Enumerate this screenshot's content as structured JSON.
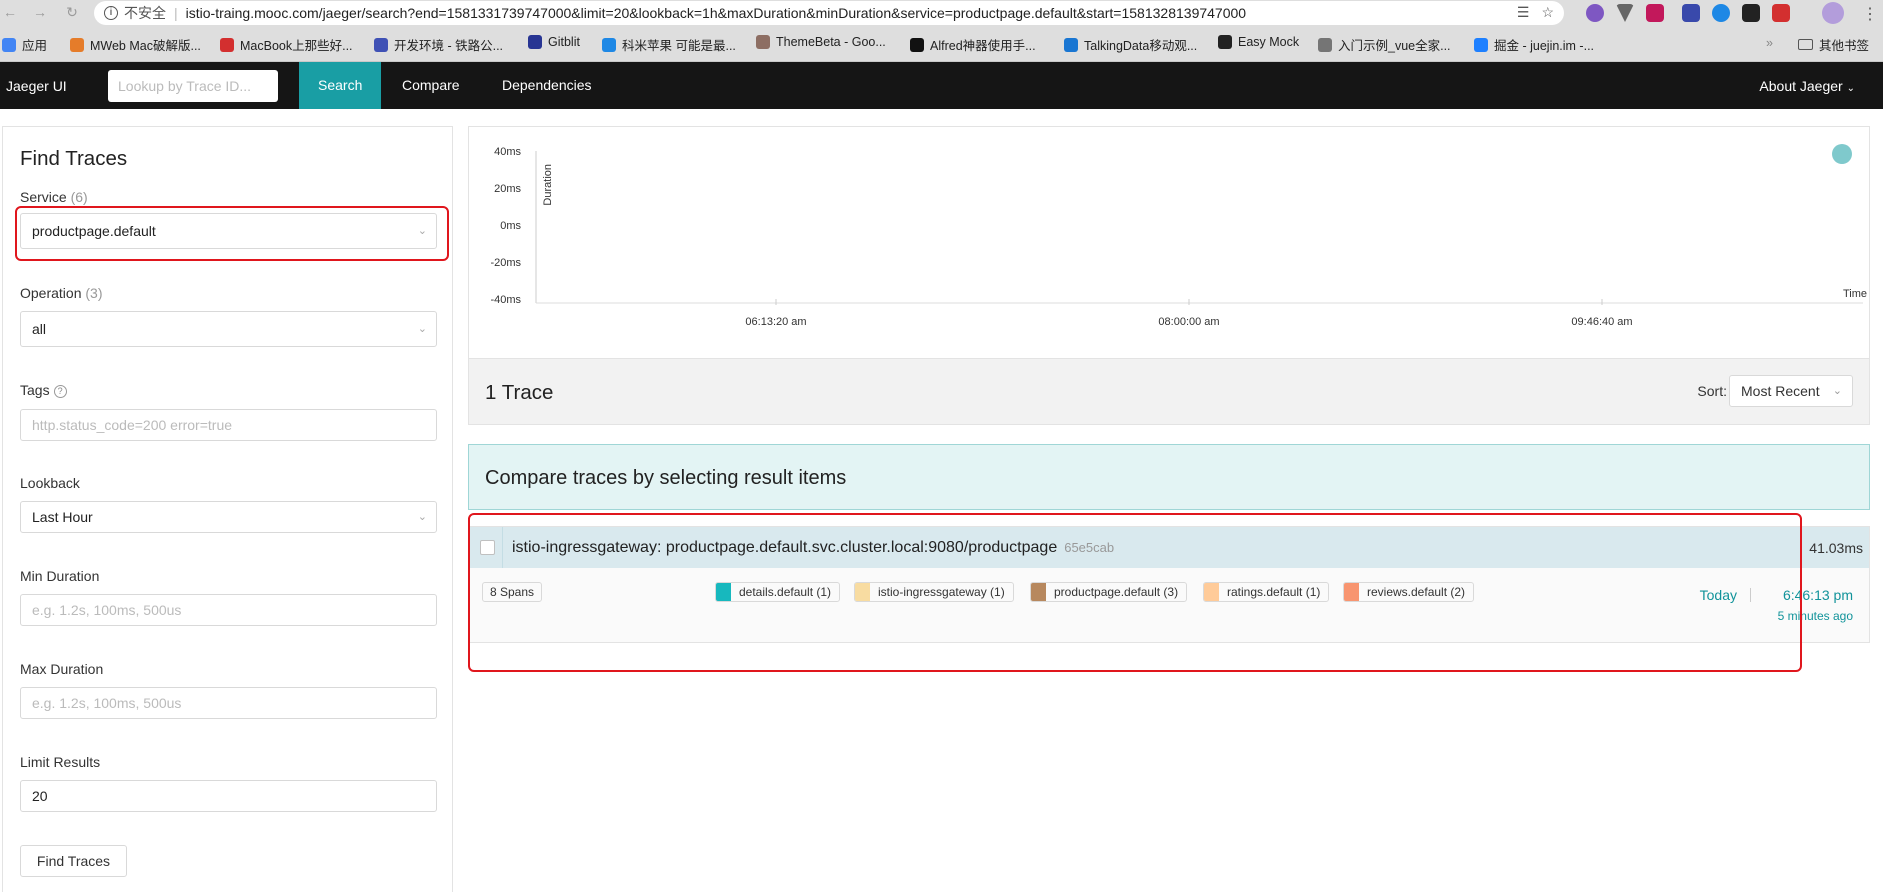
{
  "browser": {
    "security_label": "不安全",
    "url": "istio-traing.mooc.com/jaeger/search?end=1581331739747000&limit=20&lookback=1h&maxDuration&minDuration&service=productpage.default&start=1581328139747000",
    "bookmarks": [
      {
        "label": "应用",
        "color": "#4285f4"
      },
      {
        "label": "MWeb Mac破解版...",
        "color": "#e57c2a"
      },
      {
        "label": "MacBook上那些好...",
        "color": "#d32f2f"
      },
      {
        "label": "开发环境 - 铁路公...",
        "color": "#3f51b5"
      },
      {
        "label": "Gitblit",
        "color": "#283593"
      },
      {
        "label": "科米苹果 可能是最...",
        "color": "#1e88e5"
      },
      {
        "label": "ThemeBeta - Goo...",
        "color": "#8d6e63"
      },
      {
        "label": "Alfred神器使用手...",
        "color": "#111111"
      },
      {
        "label": "TalkingData移动观...",
        "color": "#1976d2"
      },
      {
        "label": "Easy Mock",
        "color": "#222222"
      },
      {
        "label": "入门示例_vue全家...",
        "color": "#757575"
      },
      {
        "label": "掘金 - juejin.im -...",
        "color": "#1e80ff"
      },
      {
        "label": "其他书签",
        "color": "#616161"
      }
    ]
  },
  "nav": {
    "brand": "Jaeger UI",
    "lookup_placeholder": "Lookup by Trace ID...",
    "links": [
      "Search",
      "Compare",
      "Dependencies"
    ],
    "about": "About Jaeger"
  },
  "form": {
    "title": "Find Traces",
    "service_label": "Service",
    "service_count": "(6)",
    "service_value": "productpage.default",
    "operation_label": "Operation",
    "operation_count": "(3)",
    "operation_value": "all",
    "tags_label": "Tags",
    "tags_placeholder": "http.status_code=200 error=true",
    "lookback_label": "Lookback",
    "lookback_value": "Last Hour",
    "min_label": "Min Duration",
    "min_placeholder": "e.g. 1.2s, 100ms, 500us",
    "max_label": "Max Duration",
    "max_placeholder": "e.g. 1.2s, 100ms, 500us",
    "limit_label": "Limit Results",
    "limit_value": "20",
    "submit": "Find Traces"
  },
  "chart_data": {
    "type": "scatter",
    "ylabel": "Duration",
    "xlabel": "Time",
    "y_ticks": [
      "40ms",
      "20ms",
      "0ms",
      "-20ms",
      "-40ms"
    ],
    "x_ticks": [
      "06:13:20 am",
      "08:00:00 am",
      "09:46:40 am"
    ],
    "point_color": "#7fc9cc"
  },
  "results": {
    "count": "1 Trace",
    "sort_label": "Sort:",
    "sort_value": "Most Recent",
    "compare_hint": "Compare traces by selecting result items"
  },
  "trace": {
    "title": "istio-ingressgateway: productpage.default.svc.cluster.local:9080/productpage",
    "id": "65e5cab",
    "duration": "41.03ms",
    "spans": "8 Spans",
    "services": [
      {
        "label": "details.default (1)",
        "color": "#17b8be"
      },
      {
        "label": "istio-ingressgateway (1)",
        "color": "#f8dca1"
      },
      {
        "label": "productpage.default (3)",
        "color": "#b7885e"
      },
      {
        "label": "ratings.default (1)",
        "color": "#ffcb99"
      },
      {
        "label": "reviews.default (2)",
        "color": "#f89570"
      }
    ],
    "date": "Today",
    "time": "6:46:13 pm",
    "ago": "5 minutes ago"
  }
}
